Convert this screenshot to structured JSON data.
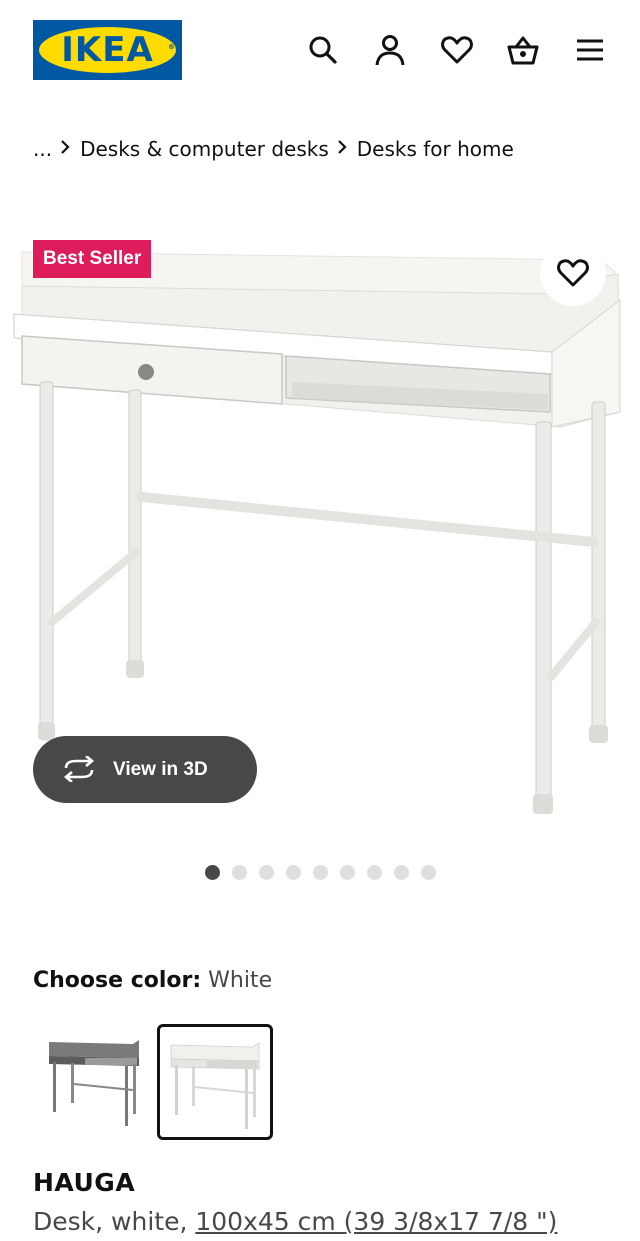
{
  "header": {
    "logo_text": "IKEA",
    "logo_mark": "®",
    "icons": [
      "search-icon",
      "account-icon",
      "favorites-icon",
      "cart-icon",
      "menu-icon"
    ]
  },
  "breadcrumb": {
    "items": [
      "...",
      "Desks & computer desks",
      "Desks for home"
    ]
  },
  "gallery": {
    "badge": "Best Seller",
    "view3d_label": "View in 3D",
    "image_count": 9,
    "active_index": 0
  },
  "color_picker": {
    "label": "Choose color:",
    "value": "White",
    "options": [
      "Gray",
      "White"
    ],
    "selected": "White"
  },
  "product": {
    "name": "HAUGA",
    "desc_prefix": "Desk, white, ",
    "size": "100x45 cm (39 3/8x17 7/8 \")"
  },
  "colors": {
    "ikea_blue": "#0058a3",
    "ikea_yellow": "#ffdb00",
    "badge": "#dc1c5b",
    "dark_button": "#484848"
  }
}
